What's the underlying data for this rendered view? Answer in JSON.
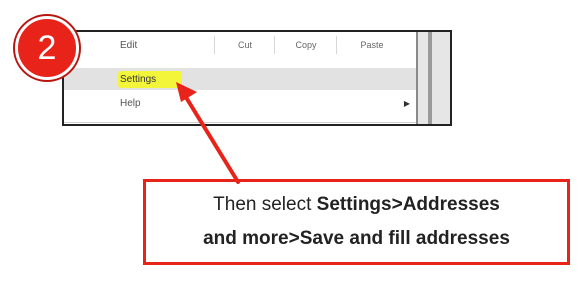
{
  "badge": {
    "step": "2"
  },
  "menu": {
    "edit_label": "Edit",
    "edit_actions": [
      "Cut",
      "Copy",
      "Paste"
    ],
    "settings_label": "Settings",
    "help_label": "Help",
    "help_submenu_icon": "chevron-right-icon"
  },
  "callout": {
    "line1_prefix": "Then select ",
    "line1_bold": "Settings>Addresses",
    "line2_bold": "and more>Save and fill addresses"
  },
  "colors": {
    "accent_red": "#e8231a",
    "highlight_yellow": "#f2f53a"
  }
}
